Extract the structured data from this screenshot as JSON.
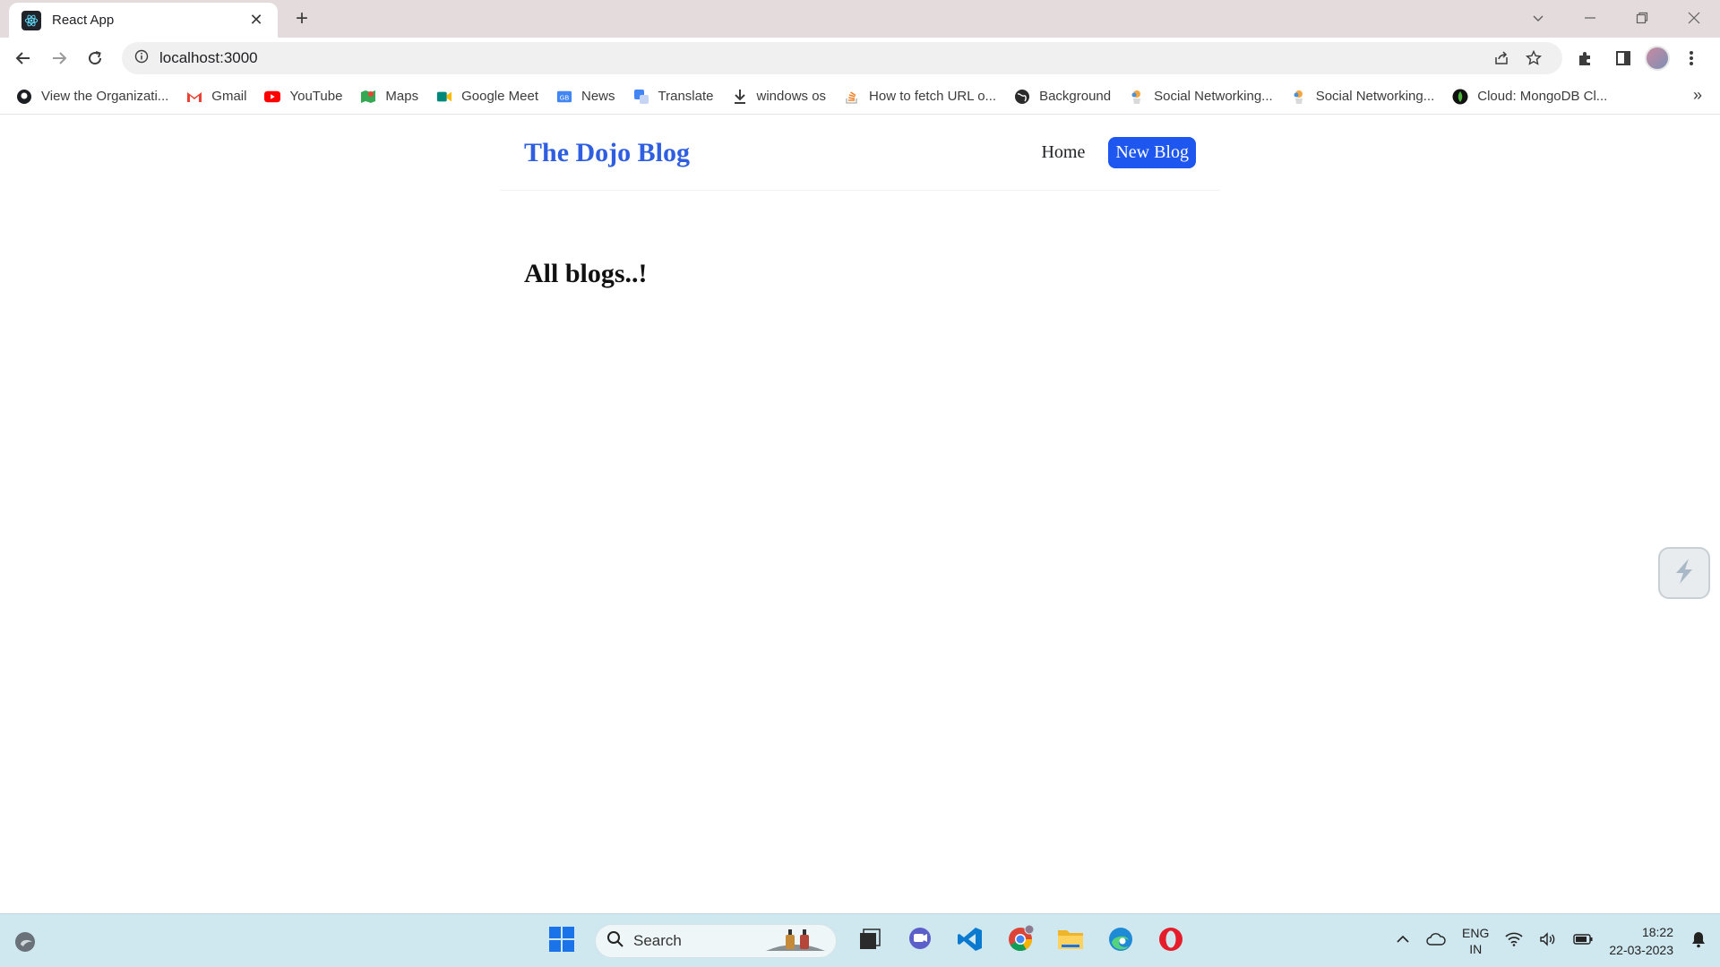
{
  "browser": {
    "tab_title": "React App",
    "address": "localhost:3000",
    "bookmarks": [
      {
        "label": "View the Organizati...",
        "icon": "github-icon"
      },
      {
        "label": "Gmail",
        "icon": "gmail-icon"
      },
      {
        "label": "YouTube",
        "icon": "youtube-icon"
      },
      {
        "label": "Maps",
        "icon": "maps-icon"
      },
      {
        "label": "Google Meet",
        "icon": "meet-icon"
      },
      {
        "label": "News",
        "icon": "news-icon"
      },
      {
        "label": "Translate",
        "icon": "translate-icon"
      },
      {
        "label": "windows os",
        "icon": "download-icon"
      },
      {
        "label": "How to fetch URL o...",
        "icon": "stackoverflow-icon"
      },
      {
        "label": "Background",
        "icon": "globe-icon"
      },
      {
        "label": "Social Networking...",
        "icon": "social-icon"
      },
      {
        "label": "Social Networking...",
        "icon": "social-icon"
      },
      {
        "label": "Cloud: MongoDB Cl...",
        "icon": "mongodb-icon"
      }
    ]
  },
  "page": {
    "brand": "The Dojo Blog",
    "nav_home": "Home",
    "nav_new": "New Blog",
    "heading": "All blogs..!"
  },
  "taskbar": {
    "search_placeholder": "Search",
    "lang_line1": "ENG",
    "lang_line2": "IN",
    "time": "18:22",
    "date": "22-03-2023"
  },
  "colors": {
    "brand": "#2f5fe0",
    "button": "#1e56f0",
    "taskbar": "#cfe7ee",
    "titlebar": "#e3dbdc"
  }
}
